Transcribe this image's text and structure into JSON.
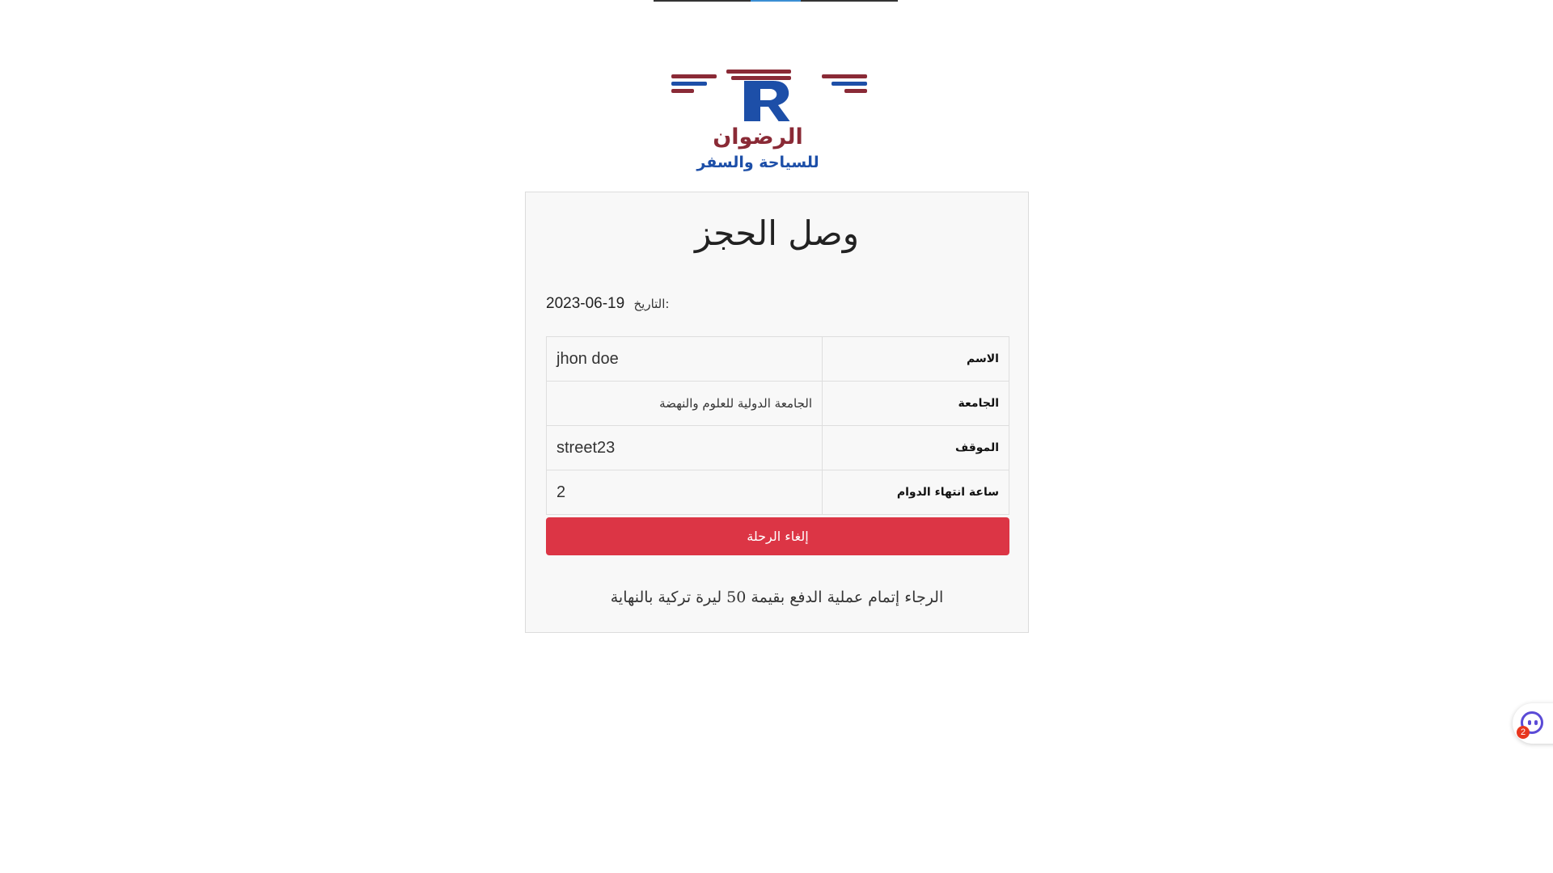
{
  "brand": {
    "name": "الرضوان",
    "tagline": "للسياحة والسفر",
    "logo_letters": "TR",
    "colors": {
      "maroon": "#8a2a36",
      "blue": "#1d4fa8"
    }
  },
  "receipt": {
    "title": "وصل الحجز",
    "date_label": "التاريخ:",
    "date_value": "2023-06-19",
    "rows": [
      {
        "label": "الاسم",
        "value": "jhon doe"
      },
      {
        "label": "الجامعة",
        "value": "الجامعة الدولية للعلوم والنهضة"
      },
      {
        "label": "الموقف",
        "value": "street23"
      },
      {
        "label": "ساعة انتهاء الدوام",
        "value": "2"
      }
    ],
    "cancel_button": "إلغاء الرحلة",
    "cancel_color": "#dc3545",
    "payment_note": "الرجاء إتمام عملية الدفع بقيمة 50 ليرة تركية بالنهاية"
  },
  "chat_widget": {
    "icon": "chat-bot-icon",
    "badge_count": "2"
  }
}
